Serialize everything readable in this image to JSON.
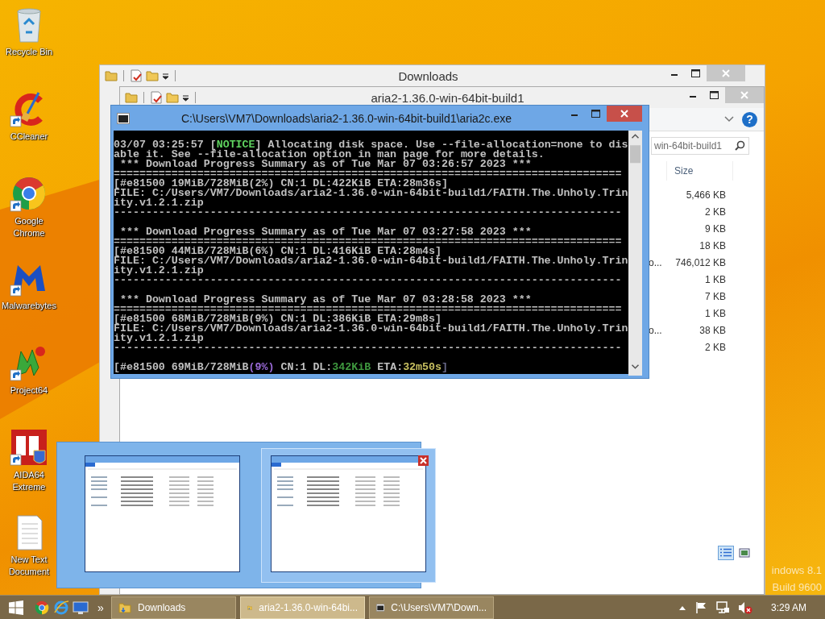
{
  "desktop": {
    "icons": [
      {
        "kind": "recycle-bin",
        "label": "Recycle Bin",
        "shortcut": false
      },
      {
        "kind": "ccleaner",
        "label": "CCleaner",
        "shortcut": true
      },
      {
        "kind": "chrome",
        "label": "Google Chrome",
        "shortcut": true
      },
      {
        "kind": "malwarebytes",
        "label": "Malwarebytes",
        "shortcut": true
      },
      {
        "kind": "project64",
        "label": "Project64",
        "shortcut": true
      },
      {
        "kind": "aida64",
        "label": "AIDA64 Extreme",
        "shortcut": true
      },
      {
        "kind": "text-file",
        "label": "New Text Document",
        "shortcut": false
      }
    ],
    "edition_mark": [
      "indows 8.1",
      "Build 9600"
    ]
  },
  "explorer_back": {
    "title": "Downloads"
  },
  "explorer_front": {
    "title": "aria2-1.36.0-win-64bit-build1",
    "help": "?",
    "search": {
      "placeholder": "win-64bit-build1"
    },
    "columns": [
      "Size"
    ],
    "rows": [
      {
        "size": "5,466 KB"
      },
      {
        "size": "2 KB"
      },
      {
        "size": "9 KB"
      },
      {
        "size": "18 KB"
      },
      {
        "name": "o...",
        "size": "746,012 KB"
      },
      {
        "size": "1 KB"
      },
      {
        "size": "7 KB"
      },
      {
        "size": "1 KB"
      },
      {
        "name": "o...",
        "size": "38 KB"
      },
      {
        "size": "2 KB"
      }
    ],
    "views": [
      {
        "kind": "details",
        "selected": true
      },
      {
        "kind": "large-icons",
        "selected": false
      }
    ]
  },
  "console": {
    "title": "C:\\Users\\VM7\\Downloads\\aria2-1.36.0-win-64bit-build1\\aria2c.exe",
    "lines": [
      {
        "kind": "text",
        "segments": [
          {
            "text": "03/07 03:25:57 ["
          },
          {
            "text": "NOTICE",
            "color": "#5fd35f"
          },
          {
            "text": "] Allocating disk space. Use --file-allocation=none to dis"
          }
        ]
      },
      {
        "kind": "text",
        "segments": [
          {
            "text": "able it. See --file-allocation option in man page for more details."
          }
        ]
      },
      {
        "kind": "text",
        "segments": [
          {
            "text": " *** Download Progress Summary as of Tue Mar 07 03:26:57 2023 ***"
          }
        ]
      },
      {
        "kind": "text",
        "segments": [
          {
            "text": "==============================================================================="
          }
        ]
      },
      {
        "kind": "text",
        "segments": [
          {
            "text": "[#e81500 19MiB/728MiB(2%) CN:1 DL:422KiB ETA:28m36s]"
          }
        ]
      },
      {
        "kind": "text",
        "segments": [
          {
            "text": "FILE: C:/Users/VM7/Downloads/aria2-1.36.0-win-64bit-build1/FAITH.The.Unholy.Trin"
          }
        ]
      },
      {
        "kind": "text",
        "segments": [
          {
            "text": "ity.v1.2.1.zip"
          }
        ]
      },
      {
        "kind": "text",
        "segments": [
          {
            "text": "-------------------------------------------------------------------------------"
          }
        ]
      },
      {
        "kind": "blank"
      },
      {
        "kind": "text",
        "segments": [
          {
            "text": " *** Download Progress Summary as of Tue Mar 07 03:27:58 2023 ***"
          }
        ]
      },
      {
        "kind": "text",
        "segments": [
          {
            "text": "==============================================================================="
          }
        ]
      },
      {
        "kind": "text",
        "segments": [
          {
            "text": "[#e81500 44MiB/728MiB(6%) CN:1 DL:416KiB ETA:28m4s]"
          }
        ]
      },
      {
        "kind": "text",
        "segments": [
          {
            "text": "FILE: C:/Users/VM7/Downloads/aria2-1.36.0-win-64bit-build1/FAITH.The.Unholy.Trin"
          }
        ]
      },
      {
        "kind": "text",
        "segments": [
          {
            "text": "ity.v1.2.1.zip"
          }
        ]
      },
      {
        "kind": "text",
        "segments": [
          {
            "text": "-------------------------------------------------------------------------------"
          }
        ]
      },
      {
        "kind": "blank"
      },
      {
        "kind": "text",
        "segments": [
          {
            "text": " *** Download Progress Summary as of Tue Mar 07 03:28:58 2023 ***"
          }
        ]
      },
      {
        "kind": "text",
        "segments": [
          {
            "text": "==============================================================================="
          }
        ]
      },
      {
        "kind": "text",
        "segments": [
          {
            "text": "[#e81500 68MiB/728MiB(9%) CN:1 DL:386KiB ETA:29m8s]"
          }
        ]
      },
      {
        "kind": "text",
        "segments": [
          {
            "text": "FILE: C:/Users/VM7/Downloads/aria2-1.36.0-win-64bit-build1/FAITH.The.Unholy.Trin"
          }
        ]
      },
      {
        "kind": "text",
        "segments": [
          {
            "text": "ity.v1.2.1.zip"
          }
        ]
      },
      {
        "kind": "text",
        "segments": [
          {
            "text": "-------------------------------------------------------------------------------"
          }
        ]
      },
      {
        "kind": "blank"
      },
      {
        "kind": "text",
        "segments": [
          {
            "text": "[#e81500 69MiB/728MiB"
          },
          {
            "text": "(9%)",
            "color": "#9a6ad8"
          },
          {
            "text": " CN:1 DL:"
          },
          {
            "text": "342KiB",
            "color": "#3f9a3f"
          },
          {
            "text": " ETA:"
          },
          {
            "text": "32m50s",
            "color": "#c8c060"
          },
          {
            "text": "]",
            "color": "#6a6a8a"
          }
        ]
      }
    ]
  },
  "thumbnail_preview": {
    "thumbnails": [
      {
        "kind": "explorer",
        "selected": false
      },
      {
        "kind": "explorer",
        "selected": true
      }
    ]
  },
  "taskbar": {
    "pinned": [
      {
        "kind": "start"
      },
      {
        "kind": "chrome"
      },
      {
        "kind": "ie"
      },
      {
        "kind": "desktop"
      }
    ],
    "overflow": "»",
    "buttons": [
      {
        "kind": "explorer",
        "label": "Downloads",
        "selected": false
      },
      {
        "kind": "explorer",
        "label": "aria2-1.36.0-win-64bi...",
        "selected": true
      },
      {
        "kind": "console",
        "label": "C:\\Users\\VM7\\Down...",
        "selected": false
      }
    ],
    "tray": [
      {
        "kind": "show-hidden"
      },
      {
        "kind": "flag"
      },
      {
        "kind": "network"
      },
      {
        "kind": "volume-muted"
      }
    ],
    "clock": "3:29 AM"
  }
}
